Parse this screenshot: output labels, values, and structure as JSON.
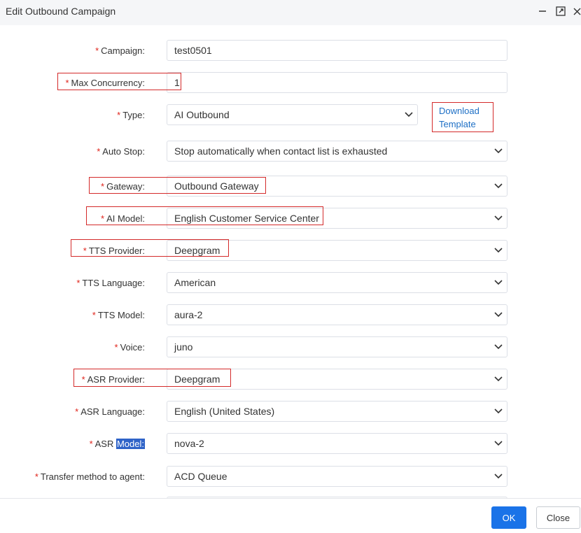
{
  "dialog": {
    "title": "Edit Outbound Campaign",
    "icons": [
      "minimize-icon",
      "maximize-icon",
      "close-icon"
    ]
  },
  "form": {
    "required_mark": "*",
    "campaign": {
      "label": "Campaign:",
      "value": "test0501"
    },
    "max_concurrency": {
      "label": "Max Concurrency:",
      "value": "1"
    },
    "type": {
      "label": "Type:",
      "value": "AI Outbound"
    },
    "download_template": {
      "line1": "Download",
      "line2": "Template"
    },
    "auto_stop": {
      "label": "Auto Stop:",
      "value": "Stop automatically when contact list is exhausted"
    },
    "gateway": {
      "label": "Gateway:",
      "value": "Outbound Gateway"
    },
    "ai_model": {
      "label": "AI Model:",
      "value": "English Customer Service Center"
    },
    "tts_provider": {
      "label": "TTS Provider:",
      "value": "Deepgram"
    },
    "tts_language": {
      "label": "TTS Language:",
      "value": "American"
    },
    "tts_model": {
      "label": "TTS Model:",
      "value": "aura-2"
    },
    "voice": {
      "label": "Voice:",
      "value": "juno"
    },
    "asr_provider": {
      "label": "ASR Provider:",
      "value": "Deepgram"
    },
    "asr_language": {
      "label": "ASR Language:",
      "value": "English (United States)"
    },
    "asr_model": {
      "label_prefix": "ASR ",
      "label_selected": "Model:",
      "value": "nova-2"
    },
    "transfer_method": {
      "label": "Transfer method to agent:",
      "value": "ACD Queue"
    }
  },
  "footer": {
    "ok_label": "OK",
    "close_label": "Close"
  },
  "colors": {
    "primary": "#1a73e8",
    "required": "#e0241b",
    "annotation": "#d42a2a",
    "selection": "#2f63c8"
  }
}
